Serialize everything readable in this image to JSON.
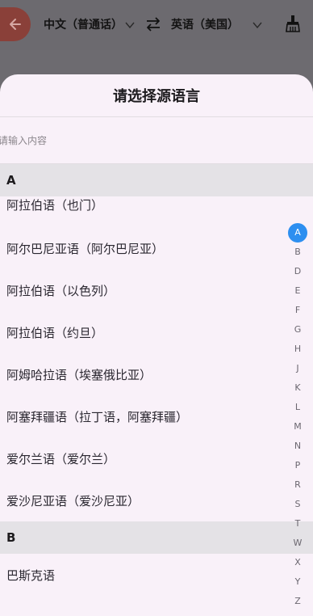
{
  "topbar": {
    "source_lang": "中文（普通话）",
    "target_lang": "英语（美国）"
  },
  "sheet": {
    "title": "请选择源语言",
    "search_placeholder": "请输入内容"
  },
  "sections": [
    {
      "letter": "A",
      "items": [
        "阿拉伯语（也门）",
        "阿尔巴尼亚语（阿尔巴尼亚）",
        "阿拉伯语（以色列）",
        "阿拉伯语（约旦）",
        "阿姆哈拉语（埃塞俄比亚）",
        "阿塞拜疆语（拉丁语，阿塞拜疆）",
        "爱尔兰语（爱尔兰）",
        "爱沙尼亚语（爱沙尼亚）"
      ]
    },
    {
      "letter": "B",
      "items": [
        "巴斯克语"
      ]
    }
  ],
  "alphabet": [
    "A",
    "B",
    "D",
    "E",
    "F",
    "G",
    "H",
    "J",
    "K",
    "L",
    "M",
    "N",
    "P",
    "R",
    "S",
    "T",
    "W",
    "X",
    "Y",
    "Z"
  ],
  "alphabet_active": "A",
  "colors": {
    "back_button": "#8a4039",
    "index_active": "#2d8ff0",
    "sheet_bg": "#f9f1f9",
    "section_bg": "#e4e2e6"
  },
  "icons": {
    "back": "arrow-left-icon",
    "swap": "swap-arrows-icon",
    "clear": "brush-icon",
    "dropdown": "chevron-down-icon"
  }
}
